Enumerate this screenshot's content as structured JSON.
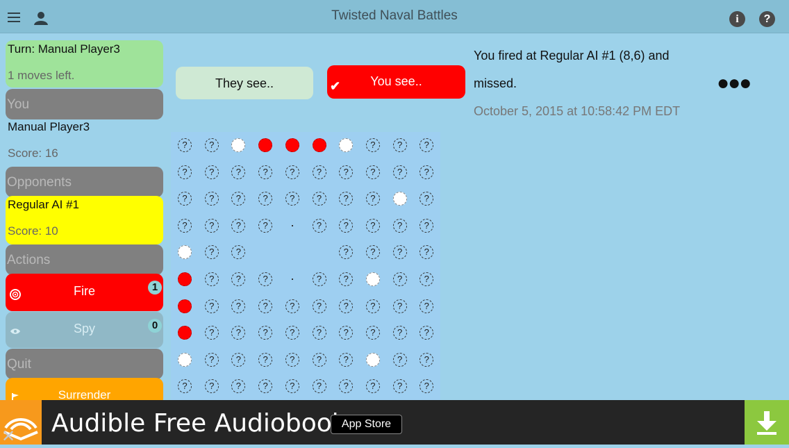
{
  "header": {
    "title": "Twisted Naval Battles"
  },
  "turn": {
    "title": "Turn: Manual Player3",
    "moves_left": "1 moves left."
  },
  "you": {
    "section_label": "You",
    "name": "Manual Player3",
    "score": "Score: 16"
  },
  "opponents": {
    "section_label": "Opponents",
    "name": "Regular AI #1",
    "score": "Score: 10"
  },
  "actions": {
    "section_label": "Actions",
    "fire_label": "Fire",
    "fire_count": "1",
    "spy_label": "Spy",
    "spy_count": "0"
  },
  "quit": {
    "section_label": "Quit",
    "surrender_label": "Surrender"
  },
  "view_toggle": {
    "they_see": "They see..",
    "you_see": "You see.."
  },
  "message": {
    "line1": "You fired at Regular AI #1 (8,6) and",
    "line2": "missed.",
    "timestamp": "October 5, 2015 at 10:58:42 PM EDT"
  },
  "board": {
    "rows": [
      "??oXXXo???",
      "??????????",
      "????????o?",
      "????.?????",
      "o??   ????",
      "X???.??o??",
      "X?????????",
      "X?????????",
      "o??????o??",
      "??????????"
    ],
    "unknown_glyph": "?",
    "hit_color": "#ff0000",
    "miss_color": "#ffffff"
  },
  "ad": {
    "text": "Audible Free Audiobook.",
    "store_label": "App Store"
  }
}
